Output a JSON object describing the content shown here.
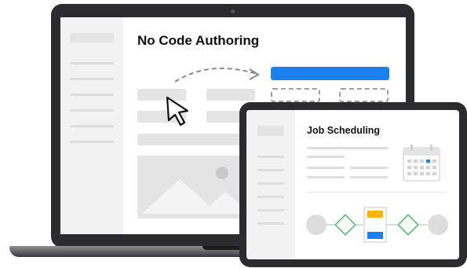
{
  "laptop": {
    "title": "No Code Authoring"
  },
  "tablet": {
    "title": "Job Scheduling"
  },
  "colors": {
    "accent_blue": "#1a82f0",
    "diamond_green": "#4cbb6c",
    "yellow": "#f7b600",
    "blue": "#1a82f0",
    "device": "#2c2c2e"
  },
  "icons": [
    "cursor-arrow-icon",
    "dashed-arrow-icon",
    "image-placeholder-icon",
    "calendar-icon",
    "diamond-icon"
  ]
}
